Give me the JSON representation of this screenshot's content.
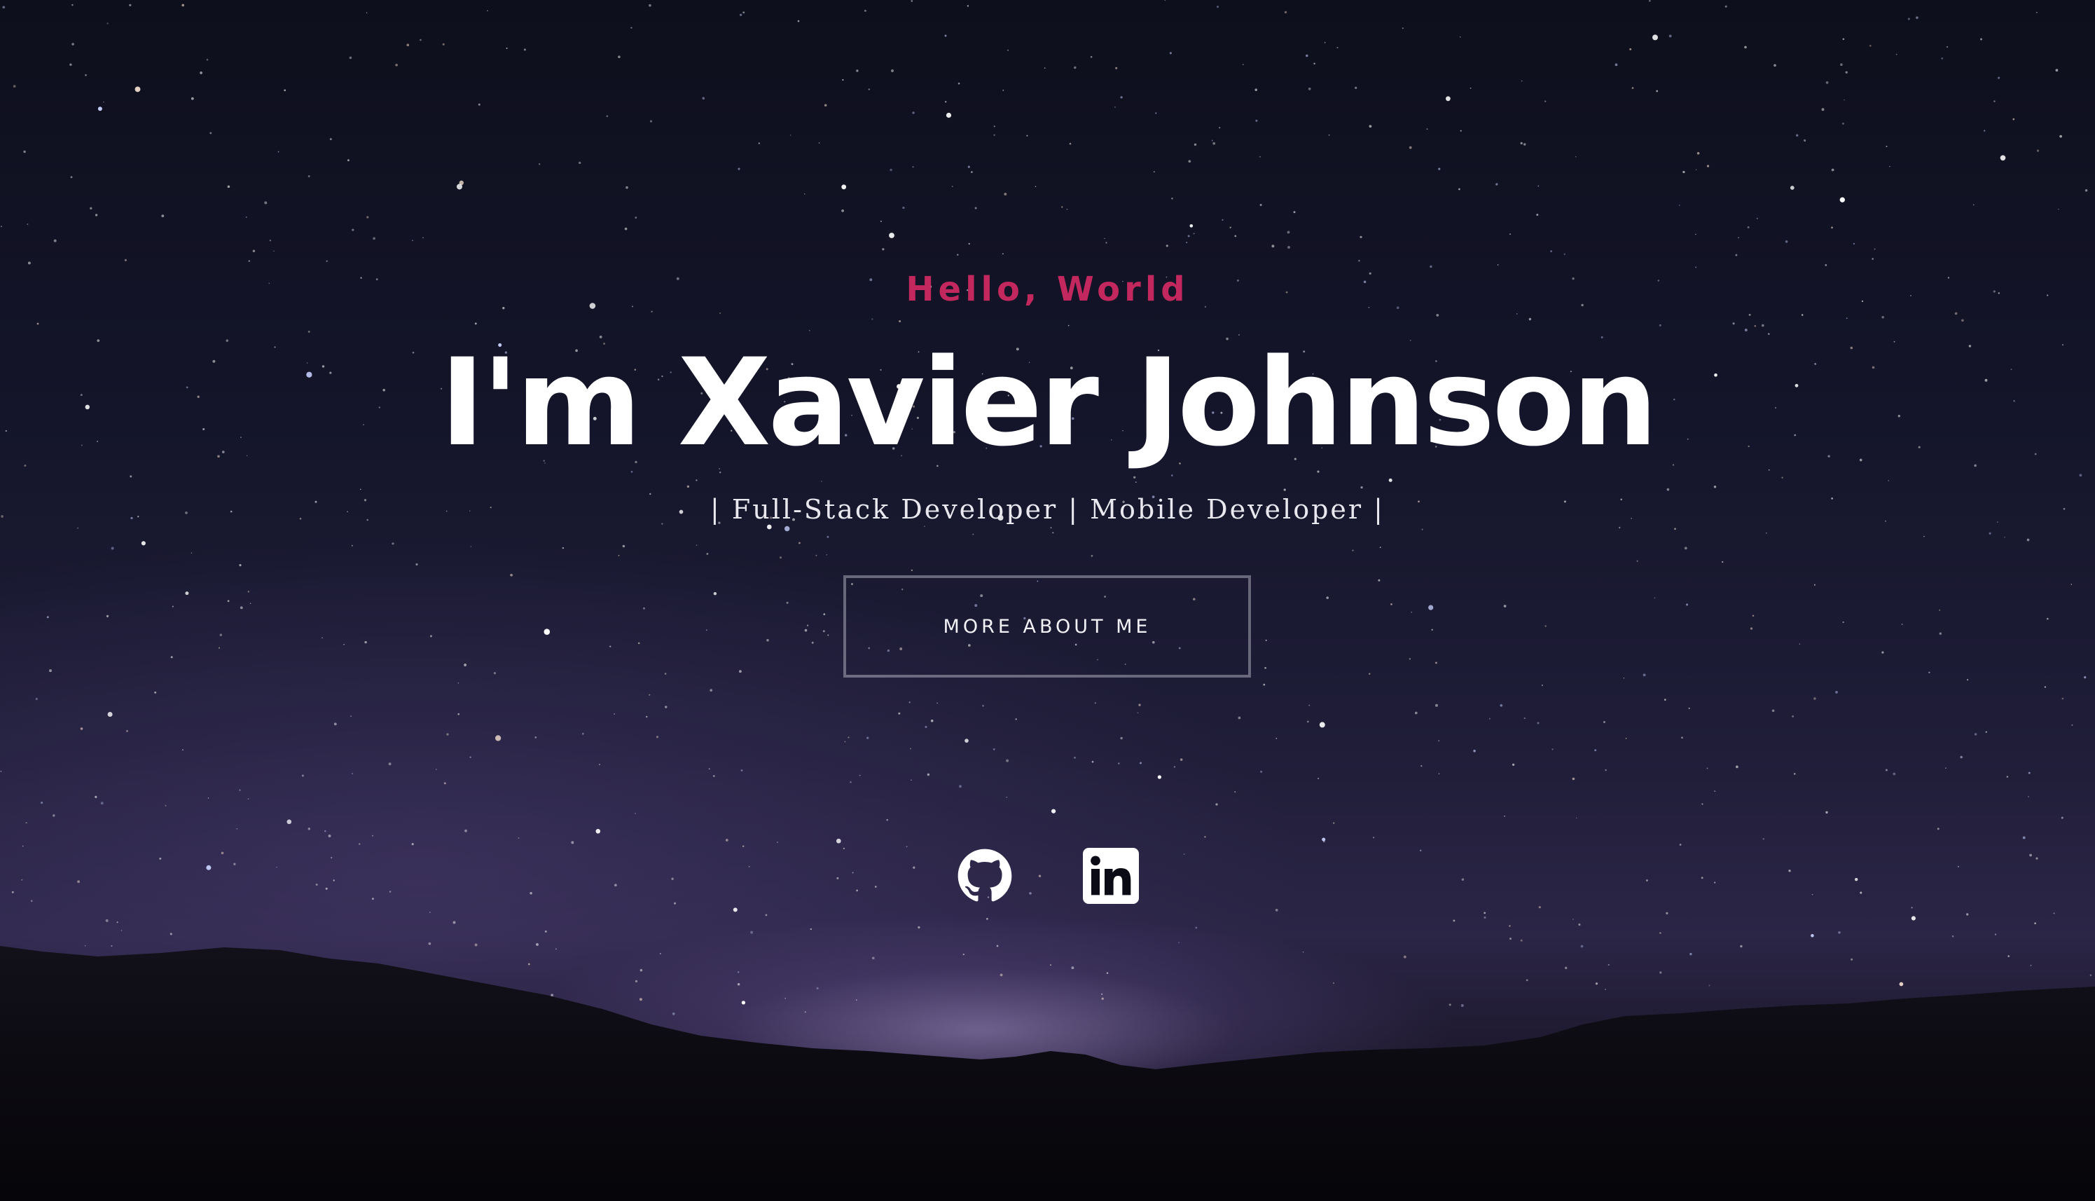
{
  "hero": {
    "greeting": "Hello, World",
    "name": "I'm Xavier Johnson",
    "tagline": "| Full-Stack Developer | Mobile Developer |",
    "cta_label": "MORE ABOUT ME"
  },
  "social": [
    {
      "icon": "github-icon"
    },
    {
      "icon": "linkedin-icon"
    }
  ],
  "colors": {
    "accent": "#c2285d",
    "text": "#ffffff",
    "button_border": "#8a8a94"
  }
}
